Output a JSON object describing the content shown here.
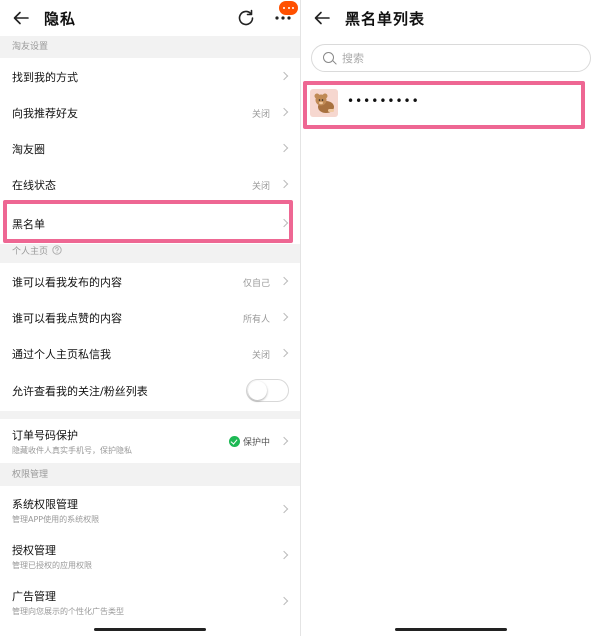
{
  "left": {
    "title": "隐私",
    "sections": {
      "friends": "淘友设置",
      "profile": "个人主页",
      "permissions": "权限管理"
    },
    "friend_items": [
      {
        "label": "找到我的方式",
        "value": ""
      },
      {
        "label": "向我推荐好友",
        "value": "关闭"
      },
      {
        "label": "淘友圈",
        "value": ""
      },
      {
        "label": "在线状态",
        "value": "关闭"
      },
      {
        "label": "黑名单",
        "value": ""
      }
    ],
    "profile_items": [
      {
        "label": "谁可以看我发布的内容",
        "value": "仅自己"
      },
      {
        "label": "谁可以看我点赞的内容",
        "value": "所有人"
      },
      {
        "label": "通过个人主页私信我",
        "value": "关闭"
      },
      {
        "label": "允许查看我的关注/粉丝列表",
        "toggle_on": false
      }
    ],
    "order_protect": {
      "label": "订单号码保护",
      "sub": "隐藏收件人真实手机号，保护隐私",
      "status": "保护中"
    },
    "permission_items": [
      {
        "label": "系统权限管理",
        "sub": "管理APP使用的系统权限"
      },
      {
        "label": "授权管理",
        "sub": "管理已授权的应用权限"
      },
      {
        "label": "广告管理",
        "sub": "管理向您展示的个性化广告类型"
      }
    ]
  },
  "right": {
    "title": "黑名单列表",
    "search_placeholder": "搜索",
    "entries": [
      {
        "name": "•••••••••"
      }
    ]
  },
  "colors": {
    "highlight": "#ee6793",
    "accent": "#ff5000",
    "status_green": "#1db954"
  }
}
